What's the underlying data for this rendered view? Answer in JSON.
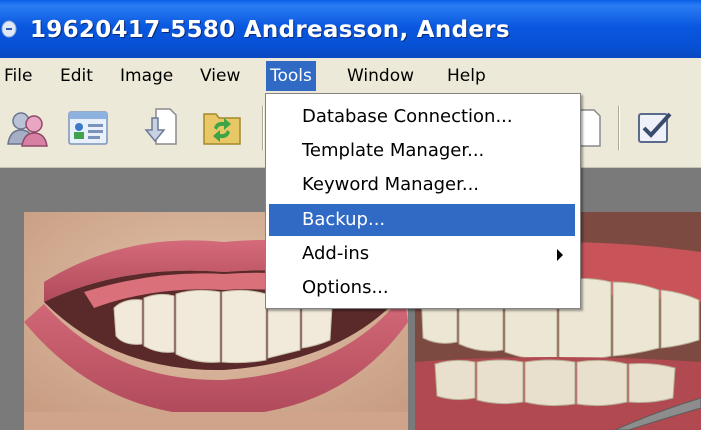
{
  "window": {
    "title": "19620417-5580 Andreasson, Anders"
  },
  "menubar": {
    "items": [
      {
        "label": "File"
      },
      {
        "label": "Edit"
      },
      {
        "label": "Image"
      },
      {
        "label": "View"
      },
      {
        "label": "Tools",
        "active": true
      },
      {
        "label": "Window"
      },
      {
        "label": "Help"
      }
    ]
  },
  "toolbar": {
    "buttons": [
      {
        "icon": "patients-icon"
      },
      {
        "icon": "patient-card-icon"
      },
      {
        "icon": "import-icon"
      },
      {
        "icon": "refresh-folder-icon"
      },
      {
        "icon": "document-icon"
      },
      {
        "icon": "checklist-icon"
      }
    ]
  },
  "tools_menu": {
    "items": [
      {
        "label": "Database Connection..."
      },
      {
        "label": "Template Manager..."
      },
      {
        "label": "Keyword Manager..."
      },
      {
        "label": "Backup...",
        "highlighted": true
      },
      {
        "label": "Add-ins",
        "submenu": true
      },
      {
        "label": "Options..."
      }
    ]
  },
  "colors": {
    "title_bar": "#0a58e0",
    "menu_highlight": "#316ac5",
    "chrome": "#ece9d8"
  }
}
